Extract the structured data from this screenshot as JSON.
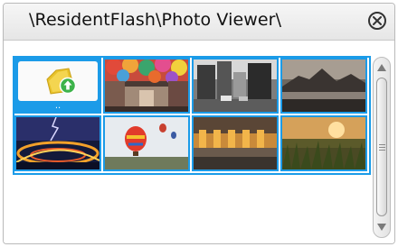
{
  "window": {
    "title": "\\ResidentFlash\\Photo Viewer\\",
    "close_icon": "close-circle-icon"
  },
  "grid": {
    "up_item": {
      "icon": "folder-up-icon",
      "label": ".."
    },
    "thumbnails": [
      {
        "name": "colorful-street-umbrellas"
      },
      {
        "name": "city-street-black-white"
      },
      {
        "name": "mountain-lake-dusk"
      },
      {
        "name": "highway-interchange-night-lightning"
      },
      {
        "name": "hot-air-balloons"
      },
      {
        "name": "dam-spillway-lights"
      },
      {
        "name": "grass-field-sunset"
      }
    ]
  },
  "scrollbar": {
    "up_icon": "arrow-up-icon",
    "down_icon": "arrow-down-icon",
    "grip_icon": "grip-lines-icon"
  },
  "colors": {
    "selection_blue": "#1b9be8",
    "titlebar_bg": "#ececec"
  }
}
